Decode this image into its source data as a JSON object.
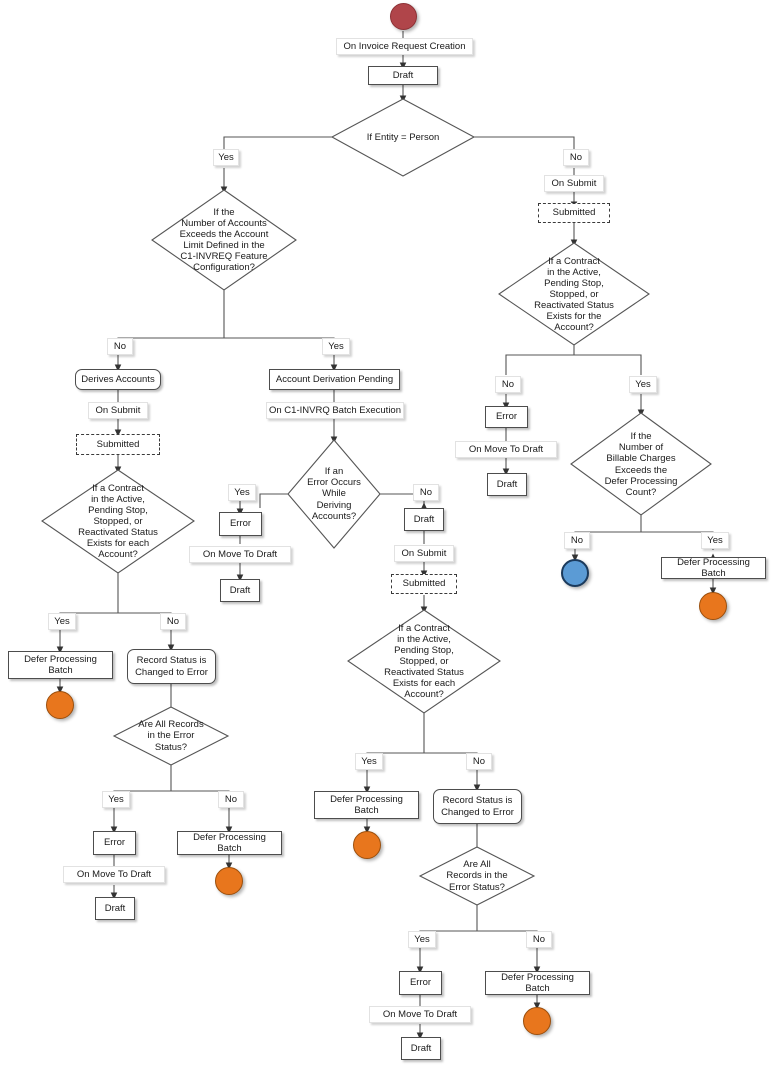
{
  "diagram": {
    "title": "Invoice Request Lifecycle Flowchart",
    "colors": {
      "start_terminator": "#b0454a",
      "defer_terminator": "#e8761d",
      "end_terminator": "#5b9bd5",
      "line": "#555555",
      "box_border": "#4d4d4d",
      "text": "#1a1a1a"
    },
    "nodes": {
      "start": "",
      "draft_top": "Draft",
      "entity_person": "If Entity = Person",
      "num_accounts_exceeds": "If the\nNumber of Accounts\nExceeds the Account\nLimit Defined in the\nC1-INVREQ Feature\nConfiguration?",
      "derives_accounts": "Derives Accounts",
      "submitted_left": "Submitted",
      "contract_each_left": "If a Contract\nin the Active,\nPending Stop,\nStopped,  or\nReactivated Status\nExists for each\nAccount?",
      "defer_left_yes": "Defer Processing Batch",
      "record_status_left": "Record Status is\nChanged to Error",
      "all_records_left": "Are All Records\nin the Error\nStatus?",
      "error_left": "Error",
      "draft_left": "Draft",
      "defer_left_no": "Defer Processing Batch",
      "account_derivation_pending": "Account Derivation Pending",
      "error_occurs": "If an\nError Occurs\nWhile\nDeriving\nAccounts?",
      "error_mid_yes": "Error",
      "draft_mid_yes": "Draft",
      "draft_mid_no": "Draft",
      "submitted_mid": "Submitted",
      "contract_each_mid": "If a Contract\nin the Active,\nPending Stop,\nStopped,  or\nReactivated Status\nExists for each\nAccount?",
      "defer_mid_yes": "Defer Processing Batch",
      "record_status_mid": "Record Status is\nChanged to Error",
      "all_records_mid": "Are All\nRecords in the\nError Status?",
      "error_mid_bottom": "Error",
      "draft_mid_bottom": "Draft",
      "defer_mid_no": "Defer Processing Batch",
      "submitted_right": "Submitted",
      "contract_the_right": "If a Contract\nin the Active,\nPending Stop,\nStopped,  or\nReactivated Status\nExists for the\nAccount?",
      "error_right": "Error",
      "draft_right": "Draft",
      "billable_charges": "If the\nNumber of\nBillable Charges\nExceeds the\nDefer Processing\nCount?",
      "defer_right_yes": "Defer Processing Batch"
    },
    "edge_labels": {
      "on_invoice_request_creation": "On Invoice Request Creation",
      "entity_yes": "Yes",
      "entity_no": "No",
      "on_submit_right": "On Submit",
      "exceeds_no": "No",
      "exceeds_yes": "Yes",
      "on_submit_left": "On Submit",
      "contract_left_yes": "Yes",
      "contract_left_no": "No",
      "all_records_left_yes": "Yes",
      "all_records_left_no": "No",
      "on_move_to_draft_left": "On Move To Draft",
      "on_c1invrq_batch": "On C1-INVRQ Batch Execution",
      "error_occurs_yes": "Yes",
      "error_occurs_no": "No",
      "on_move_to_draft_mid_yes": "On Move To Draft",
      "on_submit_mid": "On Submit",
      "contract_mid_yes": "Yes",
      "contract_mid_no": "No",
      "all_records_mid_yes": "Yes",
      "all_records_mid_no": "No",
      "on_move_to_draft_mid_bottom": "On Move To Draft",
      "contract_right_no": "No",
      "contract_right_yes": "Yes",
      "on_move_to_draft_right": "On Move To Draft",
      "billable_no": "No",
      "billable_yes": "Yes"
    }
  }
}
